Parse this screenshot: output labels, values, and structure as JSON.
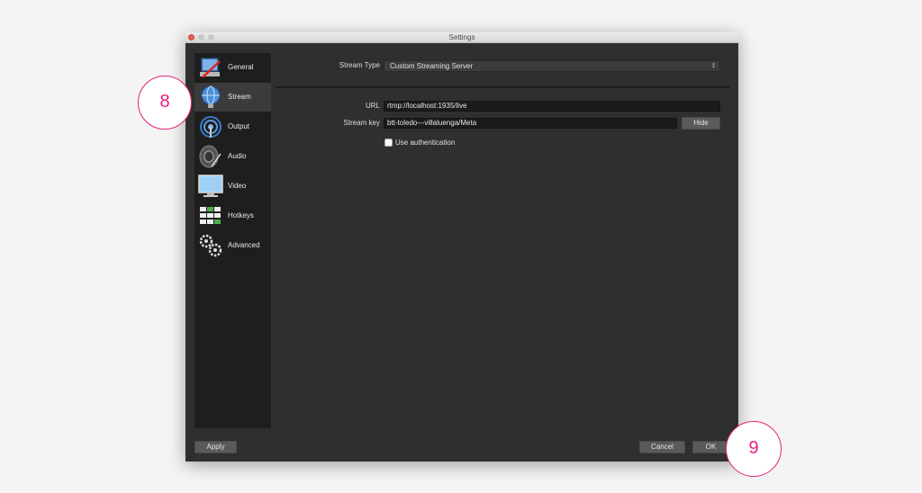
{
  "window": {
    "title": "Settings"
  },
  "sidebar": {
    "items": [
      {
        "label": "General",
        "icon": "general-icon",
        "active": false
      },
      {
        "label": "Stream",
        "icon": "stream-globe-icon",
        "active": true
      },
      {
        "label": "Output",
        "icon": "output-icon",
        "active": false
      },
      {
        "label": "Audio",
        "icon": "audio-speaker-icon",
        "active": false
      },
      {
        "label": "Video",
        "icon": "video-monitor-icon",
        "active": false
      },
      {
        "label": "Hotkeys",
        "icon": "hotkeys-keyboard-icon",
        "active": false
      },
      {
        "label": "Advanced",
        "icon": "advanced-gears-icon",
        "active": false
      }
    ]
  },
  "stream": {
    "type_label": "Stream Type",
    "type_value": "Custom Streaming Server",
    "url_label": "URL",
    "url_value": "rtmp://localhost:1935/live",
    "key_label": "Stream key",
    "key_value": "btt-toledo---villaluenga/Meta",
    "hide_label": "Hide",
    "auth_label": "Use authentication",
    "auth_checked": false
  },
  "footer": {
    "apply_label": "Apply",
    "cancel_label": "Cancel",
    "ok_label": "OK"
  },
  "callouts": [
    "8",
    "9"
  ],
  "colors": {
    "accent": "#e81e7c",
    "window_bg": "#2f2f2f",
    "sidebar_bg": "#1e1e1e"
  }
}
